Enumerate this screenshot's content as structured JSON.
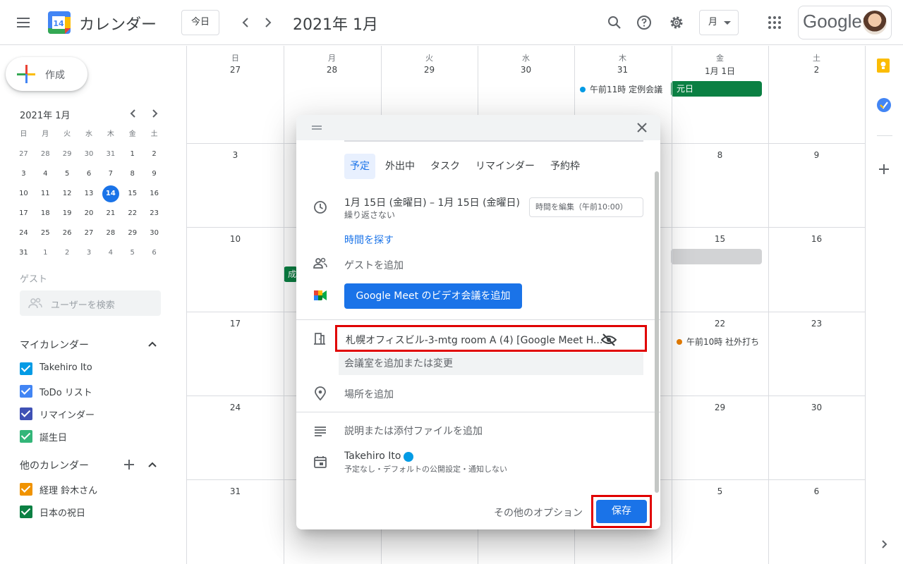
{
  "header": {
    "app_logo_day": "14",
    "app_title": "カレンダー",
    "today_button": "今日",
    "period_title": "2021年 1月",
    "view_select": "月",
    "google_word": "Google"
  },
  "sidebar": {
    "create_label": "作成",
    "mini_month_title": "2021年 1月",
    "mini_days_of_week": [
      "日",
      "月",
      "火",
      "水",
      "木",
      "金",
      "土"
    ],
    "mini_weeks": [
      [
        "27",
        "28",
        "29",
        "30",
        "31",
        "1",
        "2"
      ],
      [
        "3",
        "4",
        "5",
        "6",
        "7",
        "8",
        "9"
      ],
      [
        "10",
        "11",
        "12",
        "13",
        "14",
        "15",
        "16"
      ],
      [
        "17",
        "18",
        "19",
        "20",
        "21",
        "22",
        "23"
      ],
      [
        "24",
        "25",
        "26",
        "27",
        "28",
        "29",
        "30"
      ],
      [
        "31",
        "1",
        "2",
        "3",
        "4",
        "5",
        "6"
      ]
    ],
    "mini_today": "14",
    "guest_label": "ゲスト",
    "guest_search_placeholder": "ユーザーを検索",
    "my_calendars_title": "マイカレンダー",
    "my_calendars": [
      {
        "label": "Takehiro Ito",
        "color": "#039be5"
      },
      {
        "label": "ToDo リスト",
        "color": "#4285f4"
      },
      {
        "label": "リマインダー",
        "color": "#3f51b5"
      },
      {
        "label": "誕生日",
        "color": "#33b679"
      }
    ],
    "other_calendars_title": "他のカレンダー",
    "other_calendars": [
      {
        "label": "経理 鈴木さん",
        "color": "#f09300"
      },
      {
        "label": "日本の祝日",
        "color": "#0b8043"
      }
    ]
  },
  "calendar": {
    "days_of_week": [
      "日",
      "月",
      "火",
      "水",
      "木",
      "金",
      "土"
    ],
    "weeks": [
      [
        "27",
        "28",
        "29",
        "30",
        "31",
        "1月 1日",
        "2"
      ],
      [
        "3",
        "",
        "",
        "",
        "",
        "8",
        "9"
      ],
      [
        "10",
        "",
        "",
        "",
        "",
        "15",
        "16"
      ],
      [
        "17",
        "",
        "",
        "",
        "",
        "22",
        "23"
      ],
      [
        "24",
        "",
        "",
        "",
        "",
        "29",
        "30"
      ],
      [
        "31",
        "",
        "",
        "",
        "",
        "5",
        "6"
      ]
    ],
    "events": {
      "thu31": "午前11時 定例会議",
      "new_year": "元日",
      "fri22": "午前10時 社外打ち",
      "hidden_mon": "成"
    },
    "colors": {
      "meeting_dot": "#039be5",
      "holiday": "#0b8043",
      "external_dot": "#e67c00",
      "placeholder_block": "#d2d3d5"
    }
  },
  "dialog": {
    "tabs": [
      "予定",
      "外出中",
      "タスク",
      "リマインダー",
      "予約枠"
    ],
    "active_tab": "予定",
    "date_range": "1月 15日 (金曜日)  –  1月 15日 (金曜日)",
    "repeat": "繰り返さない",
    "time_chip": "時間を編集（午前10:00）",
    "find_time": "時間を探す",
    "add_guests": "ゲストを追加",
    "meet_button": "Google Meet のビデオ会議を追加",
    "room": "札幌オフィスビル-3-mtg room A (4) [Google Meet H...",
    "room_add": "会議室を追加または変更",
    "location": "場所を追加",
    "description": "説明または添付ファイルを追加",
    "owner": "Takehiro Ito",
    "owner_details": "予定なし・デフォルトの公開設定・通知しない",
    "more_options": "その他のオプション",
    "save": "保存"
  }
}
